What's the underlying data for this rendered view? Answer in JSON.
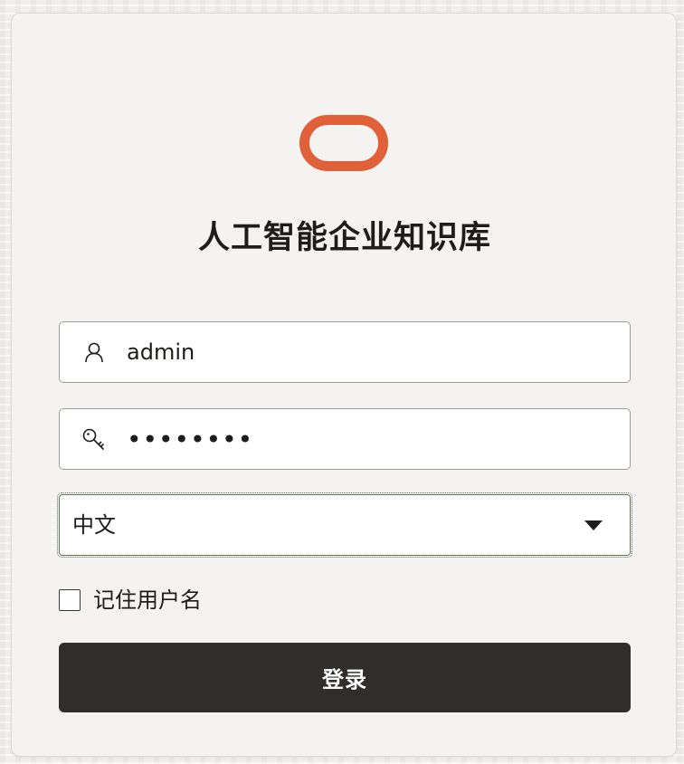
{
  "app": {
    "title": "人工智能企业知识库"
  },
  "login_form": {
    "username": {
      "icon": "user-icon",
      "value": "admin"
    },
    "password": {
      "icon": "key-icon",
      "value": "••••••••"
    },
    "language": {
      "selected": "中文",
      "icon": "chevron-down-icon"
    },
    "remember": {
      "label": "记住用户名",
      "checked": false
    },
    "submit_label": "登录"
  },
  "colors": {
    "brand": "#e0603a",
    "button_bg": "#312d2a",
    "card_bg": "#f4f3f2"
  }
}
